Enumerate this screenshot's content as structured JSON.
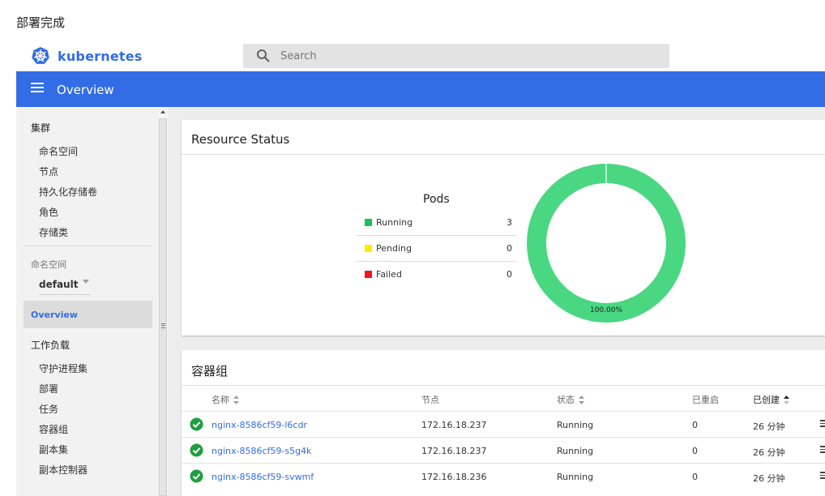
{
  "caption": "部署完成",
  "app": {
    "logo_text": "kubernetes"
  },
  "search": {
    "placeholder": "Search"
  },
  "header": {
    "title": "Overview"
  },
  "sidebar": {
    "cluster_heading": "集群",
    "cluster_items": [
      "命名空间",
      "节点",
      "持久化存储卷",
      "角色",
      "存储类"
    ],
    "namespace_label": "命名空间",
    "namespace_value": "default",
    "active_item": "Overview",
    "workloads_heading": "工作负载",
    "workload_items": [
      "守护进程集",
      "部署",
      "任务",
      "容器组",
      "副本集",
      "副本控制器"
    ]
  },
  "resource_status": {
    "title": "Resource Status",
    "legend_title": "Pods",
    "legend": [
      {
        "label": "Running",
        "count": "3",
        "color": "#18c25a"
      },
      {
        "label": "Pending",
        "count": "0",
        "color": "#ffea00"
      },
      {
        "label": "Failed",
        "count": "0",
        "color": "#f0141e"
      }
    ],
    "donut_label": "100.00%",
    "donut_color": "#4ad782"
  },
  "pods": {
    "title": "容器组",
    "columns": [
      "名称",
      "节点",
      "状态",
      "已重启",
      "已创建"
    ],
    "rows": [
      {
        "name": "nginx-8586cf59-l6cdr",
        "node": "172.16.18.237",
        "status": "Running",
        "restarts": "0",
        "age": "26 分钟"
      },
      {
        "name": "nginx-8586cf59-s5g4k",
        "node": "172.16.18.237",
        "status": "Running",
        "restarts": "0",
        "age": "26 分钟"
      },
      {
        "name": "nginx-8586cf59-svwmf",
        "node": "172.16.18.236",
        "status": "Running",
        "restarts": "0",
        "age": "26 分钟"
      }
    ]
  },
  "colors": {
    "brand": "#326ce5",
    "header_bg": "#326de6",
    "ok": "#1e9e3e"
  }
}
